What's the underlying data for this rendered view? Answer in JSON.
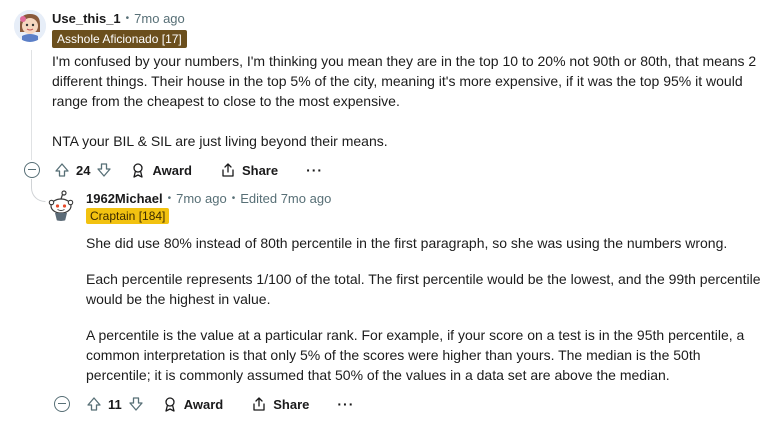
{
  "comment1": {
    "author": "Use_this_1",
    "time": "7mo ago",
    "flair": "Asshole Aficionado [17]",
    "paragraphs": [
      "I'm confused by your numbers, I'm thinking you mean they are in the top 10 to 20% not 90th or 80th, that means 2 different things. Their house in the top 5% of the city, meaning it's more expensive, if it was the top 95% it would range from the cheapest to close to the most expensive.",
      "NTA your BIL & SIL are just living beyond their means."
    ],
    "votes": "24",
    "award_label": "Award",
    "share_label": "Share",
    "more_label": "···"
  },
  "comment2": {
    "author": "1962Michael",
    "time": "7mo ago",
    "edited": "Edited 7mo ago",
    "flair": "Craptain [184]",
    "paragraphs": [
      "She did use 80% instead of 80th percentile in the first paragraph, so she was using the numbers wrong.",
      "Each percentile represents 1/100 of the total. The first percentile would be the lowest, and the 99th percentile would be the highest in value.",
      "A percentile is the value at a particular rank. For example, if your score on a test is in the 95th percentile, a common interpretation is that only 5% of the scores were higher than yours. The median is the 50th percentile; it is commonly assumed that 50% of the values in a data set are above the median."
    ],
    "votes": "11",
    "award_label": "Award",
    "share_label": "Share",
    "more_label": "···"
  },
  "colors": {
    "flair1_bg": "#6b4f1d",
    "flair2_bg": "#f2c210",
    "meta_gray": "#576f76"
  }
}
